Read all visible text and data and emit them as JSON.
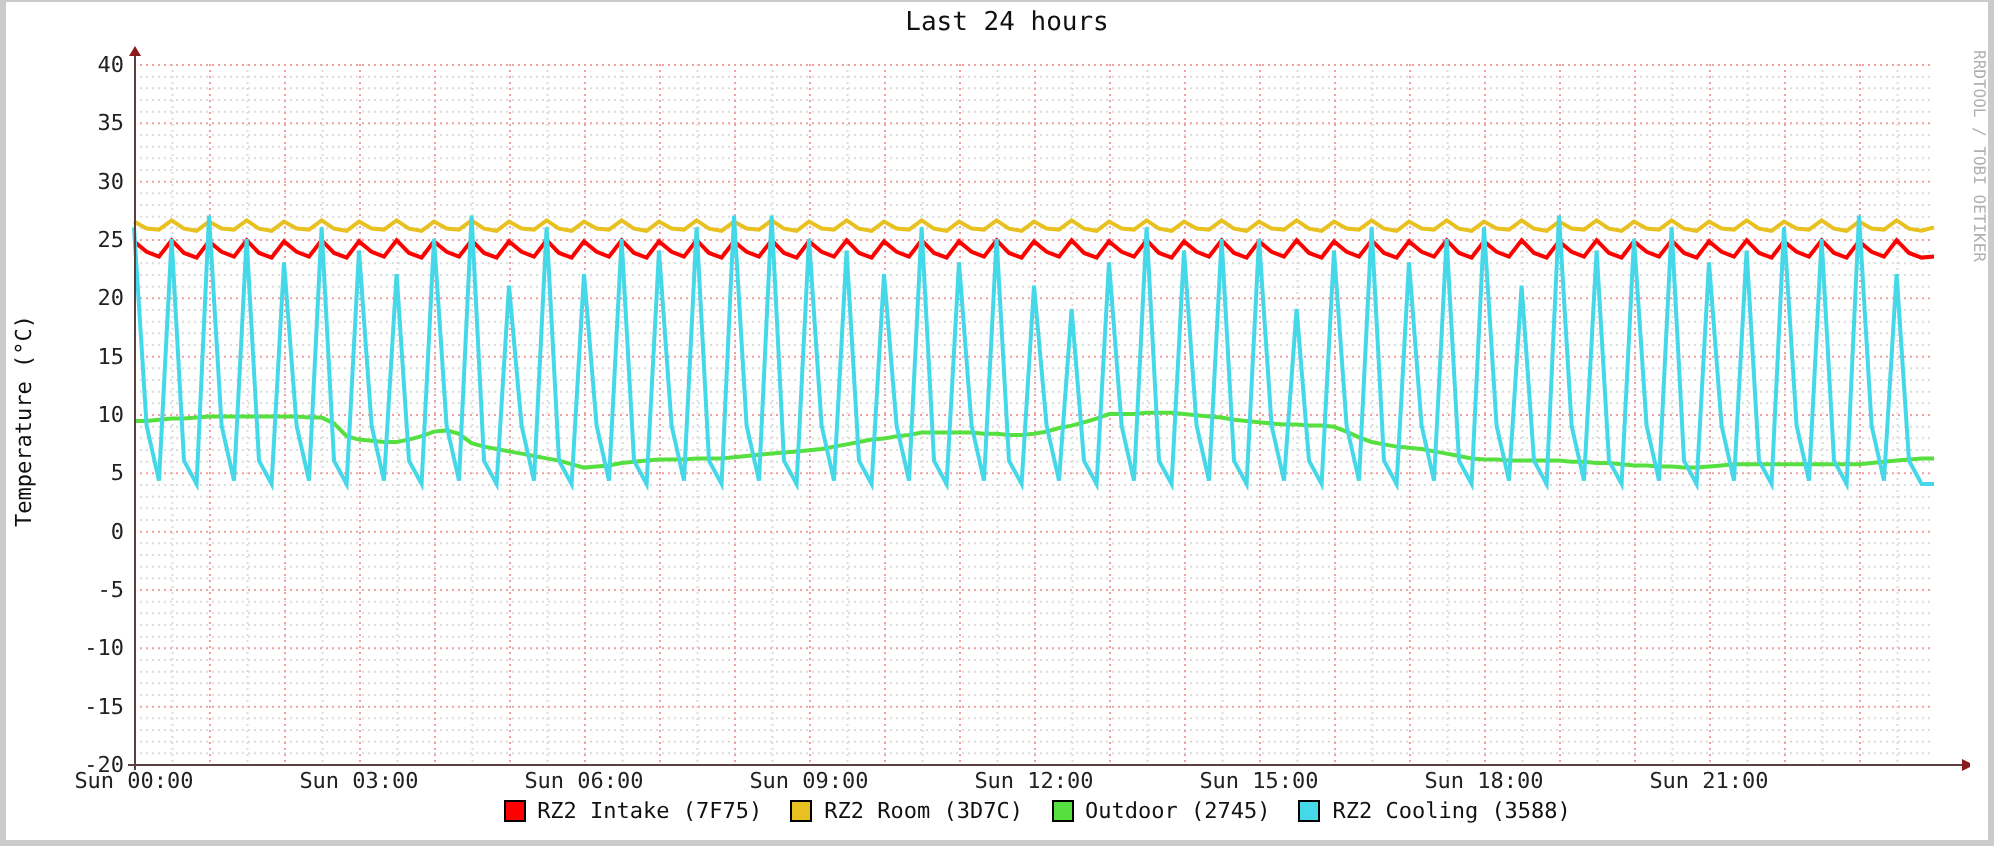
{
  "chart": {
    "credit": "RRDTOOL / TOBI OETIKER",
    "chart_data": {
      "type": "line",
      "title": "Last 24 hours",
      "ylabel": "Temperature (°C)",
      "grid": true,
      "ylim": [
        -20,
        40
      ],
      "yticks": [
        -20,
        -15,
        -10,
        -5,
        0,
        5,
        10,
        15,
        20,
        25,
        30,
        35,
        40
      ],
      "categories": [
        "Sun 00:00",
        null,
        null,
        null,
        null,
        null,
        null,
        null,
        null,
        null,
        null,
        null,
        null,
        null,
        null,
        null,
        null,
        null,
        "Sun 03:00",
        null,
        null,
        null,
        null,
        null,
        null,
        null,
        null,
        null,
        null,
        null,
        null,
        null,
        null,
        null,
        null,
        null,
        "Sun 06:00",
        null,
        null,
        null,
        null,
        null,
        null,
        null,
        null,
        null,
        null,
        null,
        null,
        null,
        null,
        null,
        null,
        null,
        "Sun 09:00",
        null,
        null,
        null,
        null,
        null,
        null,
        null,
        null,
        null,
        null,
        null,
        null,
        null,
        null,
        null,
        null,
        null,
        "Sun 12:00",
        null,
        null,
        null,
        null,
        null,
        null,
        null,
        null,
        null,
        null,
        null,
        null,
        null,
        null,
        null,
        null,
        null,
        "Sun 15:00",
        null,
        null,
        null,
        null,
        null,
        null,
        null,
        null,
        null,
        null,
        null,
        null,
        null,
        null,
        null,
        null,
        null,
        "Sun 18:00",
        null,
        null,
        null,
        null,
        null,
        null,
        null,
        null,
        null,
        null,
        null,
        null,
        null,
        null,
        null,
        null,
        null,
        "Sun 21:00",
        null,
        null,
        null,
        null,
        null,
        null,
        null,
        null,
        null,
        null,
        null,
        null,
        null,
        null,
        null,
        null,
        null,
        null
      ],
      "series": [
        {
          "name": "RZ2 Intake (7F75)",
          "color": "#ff0000",
          "values": [
            24.8,
            23.9,
            23.5,
            24.9,
            23.8,
            23.4,
            24.8,
            23.9,
            23.5,
            24.9,
            23.8,
            23.4,
            24.8,
            23.9,
            23.5,
            24.9,
            23.8,
            23.4,
            24.8,
            23.9,
            23.5,
            24.9,
            23.8,
            23.4,
            24.8,
            23.9,
            23.5,
            24.9,
            23.8,
            23.4,
            24.8,
            23.9,
            23.5,
            24.9,
            23.8,
            23.4,
            24.8,
            23.9,
            23.5,
            24.9,
            23.8,
            23.4,
            24.8,
            23.9,
            23.5,
            24.9,
            23.8,
            23.4,
            24.8,
            23.9,
            23.5,
            24.9,
            23.8,
            23.4,
            24.8,
            23.9,
            23.5,
            24.9,
            23.8,
            23.4,
            24.8,
            23.9,
            23.5,
            24.9,
            23.8,
            23.4,
            24.8,
            23.9,
            23.5,
            24.9,
            23.8,
            23.4,
            24.8,
            23.9,
            23.5,
            24.9,
            23.8,
            23.4,
            24.8,
            23.9,
            23.5,
            24.9,
            23.8,
            23.4,
            24.8,
            23.9,
            23.5,
            24.9,
            23.8,
            23.4,
            24.8,
            23.9,
            23.5,
            24.9,
            23.8,
            23.4,
            24.8,
            23.9,
            23.5,
            24.9,
            23.8,
            23.4,
            24.8,
            23.9,
            23.5,
            24.9,
            23.8,
            23.4,
            24.8,
            23.9,
            23.5,
            24.9,
            23.8,
            23.4,
            24.8,
            23.9,
            23.5,
            24.9,
            23.8,
            23.4,
            24.8,
            23.9,
            23.5,
            24.9,
            23.8,
            23.4,
            24.8,
            23.9,
            23.5,
            24.9,
            23.8,
            23.4,
            24.8,
            23.9,
            23.5,
            24.9,
            23.8,
            23.4,
            24.8,
            23.9,
            23.5,
            24.9,
            23.8,
            23.4,
            23.5
          ]
        },
        {
          "name": "RZ2 Room (3D7C)",
          "color": "#e8c020",
          "values": [
            26.5,
            25.9,
            25.8,
            26.6,
            25.9,
            25.7,
            26.5,
            25.9,
            25.8,
            26.6,
            25.9,
            25.7,
            26.5,
            25.9,
            25.8,
            26.6,
            25.9,
            25.7,
            26.5,
            25.9,
            25.8,
            26.6,
            25.9,
            25.7,
            26.5,
            25.9,
            25.8,
            26.6,
            25.9,
            25.7,
            26.5,
            25.9,
            25.8,
            26.6,
            25.9,
            25.7,
            26.5,
            25.9,
            25.8,
            26.6,
            25.9,
            25.7,
            26.5,
            25.9,
            25.8,
            26.6,
            25.9,
            25.7,
            26.5,
            25.9,
            25.8,
            26.6,
            25.9,
            25.7,
            26.5,
            25.9,
            25.8,
            26.6,
            25.9,
            25.7,
            26.5,
            25.9,
            25.8,
            26.6,
            25.9,
            25.7,
            26.5,
            25.9,
            25.8,
            26.6,
            25.9,
            25.7,
            26.5,
            25.9,
            25.8,
            26.6,
            25.9,
            25.7,
            26.5,
            25.9,
            25.8,
            26.6,
            25.9,
            25.7,
            26.5,
            25.9,
            25.8,
            26.6,
            25.9,
            25.7,
            26.5,
            25.9,
            25.8,
            26.6,
            25.9,
            25.7,
            26.5,
            25.9,
            25.8,
            26.6,
            25.9,
            25.7,
            26.5,
            25.9,
            25.8,
            26.6,
            25.9,
            25.7,
            26.5,
            25.9,
            25.8,
            26.6,
            25.9,
            25.7,
            26.5,
            25.9,
            25.8,
            26.6,
            25.9,
            25.7,
            26.5,
            25.9,
            25.8,
            26.6,
            25.9,
            25.7,
            26.5,
            25.9,
            25.8,
            26.6,
            25.9,
            25.7,
            26.5,
            25.9,
            25.8,
            26.6,
            25.9,
            25.7,
            26.5,
            25.9,
            25.8,
            26.6,
            25.9,
            25.7,
            26.0
          ]
        },
        {
          "name": "Outdoor (2745)",
          "color": "#55e040",
          "values": [
            9.4,
            9.4,
            9.5,
            9.6,
            9.6,
            9.7,
            9.8,
            9.8,
            9.8,
            9.8,
            9.8,
            9.8,
            9.8,
            9.8,
            9.7,
            9.7,
            9.2,
            8.1,
            7.8,
            7.7,
            7.6,
            7.6,
            7.8,
            8.1,
            8.5,
            8.6,
            8.3,
            7.5,
            7.2,
            7.0,
            6.8,
            6.6,
            6.4,
            6.2,
            6.0,
            5.7,
            5.4,
            5.5,
            5.6,
            5.8,
            5.9,
            6.0,
            6.1,
            6.1,
            6.1,
            6.2,
            6.2,
            6.2,
            6.3,
            6.4,
            6.5,
            6.6,
            6.7,
            6.8,
            6.9,
            7.0,
            7.2,
            7.4,
            7.6,
            7.8,
            7.9,
            8.1,
            8.2,
            8.4,
            8.4,
            8.4,
            8.4,
            8.4,
            8.3,
            8.3,
            8.2,
            8.2,
            8.3,
            8.5,
            8.8,
            9.0,
            9.3,
            9.6,
            10.0,
            10.0,
            10.0,
            10.1,
            10.1,
            10.1,
            10.0,
            9.9,
            9.8,
            9.7,
            9.5,
            9.4,
            9.3,
            9.2,
            9.1,
            9.1,
            9.0,
            9.0,
            8.9,
            8.5,
            8.0,
            7.6,
            7.4,
            7.2,
            7.1,
            7.0,
            6.8,
            6.6,
            6.4,
            6.2,
            6.1,
            6.1,
            6.0,
            6.0,
            6.0,
            6.0,
            6.0,
            5.9,
            5.9,
            5.8,
            5.8,
            5.7,
            5.6,
            5.6,
            5.5,
            5.5,
            5.4,
            5.4,
            5.5,
            5.6,
            5.7,
            5.7,
            5.7,
            5.7,
            5.7,
            5.7,
            5.7,
            5.7,
            5.7,
            5.7,
            5.7,
            5.8,
            5.9,
            6.0,
            6.1,
            6.2,
            6.2
          ]
        },
        {
          "name": "RZ2 Cooling (3588)",
          "color": "#45d8e8",
          "values": [
            26,
            9,
            4.3,
            25,
            6,
            4.0,
            27,
            9,
            4.3,
            25,
            6,
            4.0,
            23,
            9,
            4.3,
            26,
            6,
            4.0,
            24,
            9,
            4.3,
            22,
            6,
            4.0,
            25,
            9,
            4.3,
            27,
            6,
            4.0,
            21,
            9,
            4.3,
            26,
            6,
            4.0,
            22,
            9,
            4.3,
            25,
            6,
            4.0,
            24,
            9,
            4.3,
            26,
            6,
            4.0,
            27,
            9,
            4.3,
            27,
            6,
            4.0,
            25,
            9,
            4.3,
            24,
            6,
            4.0,
            22,
            9,
            4.3,
            26,
            6,
            4.0,
            23,
            9,
            4.3,
            25,
            6,
            4.0,
            21,
            9,
            4.3,
            19,
            6,
            4.0,
            23,
            9,
            4.3,
            26,
            6,
            4.0,
            24,
            9,
            4.3,
            25,
            6,
            4.0,
            25,
            9,
            4.3,
            19,
            6,
            4.0,
            24,
            9,
            4.3,
            26,
            6,
            4.0,
            23,
            9,
            4.3,
            25,
            6,
            4.0,
            26,
            9,
            4.3,
            21,
            6,
            4.0,
            27,
            9,
            4.3,
            24,
            6,
            4.0,
            25,
            9,
            4.3,
            26,
            6,
            4.0,
            23,
            9,
            4.3,
            24,
            6,
            4.0,
            26,
            9,
            4.3,
            25,
            6,
            4.0,
            27,
            9,
            4.3,
            22,
            6,
            4.0,
            4.0
          ]
        }
      ]
    }
  }
}
